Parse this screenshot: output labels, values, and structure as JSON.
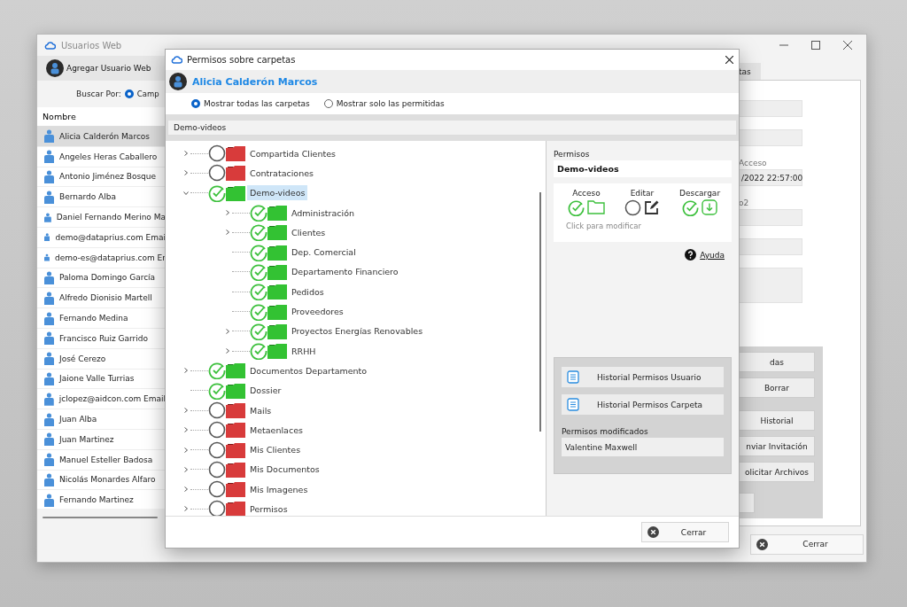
{
  "main_window": {
    "title": "Usuarios Web",
    "add_button": "Agregar Usuario Web",
    "search_label": "Buscar Por:",
    "search_option": {
      "label": "Camp",
      "selected": true
    },
    "list_header": "Nombre",
    "users": [
      {
        "name": "Alicia Calderón Marcos",
        "selected": true
      },
      {
        "name": "Angeles Heras Caballero",
        "selected": false
      },
      {
        "name": "Antonio Jiménez Bosque",
        "selected": false
      },
      {
        "name": "Bernardo Alba",
        "selected": false
      },
      {
        "name": "Daniel Fernando Merino Ma",
        "selected": false
      },
      {
        "name": "demo@dataprius.com Emai",
        "selected": false
      },
      {
        "name": "demo-es@dataprius.com Er",
        "selected": false
      },
      {
        "name": "Paloma Domingo García",
        "selected": false
      },
      {
        "name": "Alfredo Dionisio Martell",
        "selected": false
      },
      {
        "name": "Fernando Medina",
        "selected": false
      },
      {
        "name": "Francisco Ruiz Garrido",
        "selected": false
      },
      {
        "name": "José Cerezo",
        "selected": false
      },
      {
        "name": "Jaione Valle Turrias",
        "selected": false
      },
      {
        "name": "jclopez@aidcon.com Email",
        "selected": false
      },
      {
        "name": "Juan Alba",
        "selected": false
      },
      {
        "name": "Juan Martinez",
        "selected": false
      },
      {
        "name": "Manuel Esteller Badosa",
        "selected": false
      },
      {
        "name": "Nicolás Monardes Alfaro",
        "selected": false
      },
      {
        "name": "Fernando Martinez",
        "selected": false
      }
    ],
    "tab": "tas",
    "fields": [
      {
        "kind": "field"
      },
      {
        "kind": "field"
      },
      {
        "kind": "field",
        "label": "Acceso",
        "value": "/2022 22:57:00"
      },
      {
        "kind": "field",
        "label": "o2"
      },
      {
        "kind": "field"
      },
      {
        "kind": "textarea"
      }
    ],
    "buttons": [
      "das",
      "Borrar",
      "Historial",
      "nviar Invitación",
      "olicitar Archivos"
    ],
    "close_button": "Cerrar"
  },
  "dialog": {
    "title": "Permisos sobre carpetas",
    "user": "Alicia Calderón Marcos",
    "filters": [
      {
        "label": "Mostrar todas las carpetas",
        "selected": true
      },
      {
        "label": "Mostrar solo las permitidas",
        "selected": false
      }
    ],
    "path": "Demo-videos",
    "folders": [
      {
        "name": "Compartida Clientes",
        "granted": false,
        "selected": false,
        "expanded": false
      },
      {
        "name": "Contrataciones",
        "granted": false,
        "selected": false,
        "expanded": false
      },
      {
        "name": "Demo-videos",
        "granted": true,
        "selected": true,
        "expanded": true,
        "children": [
          {
            "name": "Administración",
            "granted": true,
            "selected": false,
            "expanded": false
          },
          {
            "name": "Clientes",
            "granted": true,
            "selected": false,
            "expanded": false
          },
          {
            "name": "Dep. Comercial",
            "granted": true,
            "selected": false
          },
          {
            "name": "Departamento Financiero",
            "granted": true,
            "selected": false
          },
          {
            "name": "Pedidos",
            "granted": true,
            "selected": false
          },
          {
            "name": "Proveedores",
            "granted": true,
            "selected": false
          },
          {
            "name": "Proyectos Energías Renovables",
            "granted": true,
            "selected": false,
            "expanded": false
          },
          {
            "name": "RRHH",
            "granted": true,
            "selected": false,
            "expanded": false
          }
        ]
      },
      {
        "name": "Documentos Departamento",
        "granted": true,
        "selected": false,
        "expanded": false
      },
      {
        "name": "Dossier",
        "granted": true,
        "selected": false
      },
      {
        "name": "Mails",
        "granted": false,
        "selected": false,
        "expanded": false
      },
      {
        "name": "Metaenlaces",
        "granted": false,
        "selected": false,
        "expanded": false
      },
      {
        "name": "Mis Clientes",
        "granted": false,
        "selected": false,
        "expanded": false
      },
      {
        "name": "Mis Documentos",
        "granted": false,
        "selected": false,
        "expanded": false
      },
      {
        "name": "Mis Imagenes",
        "granted": false,
        "selected": false,
        "expanded": false
      },
      {
        "name": "Permisos",
        "granted": false,
        "selected": false,
        "expanded": false
      }
    ],
    "permissions_label": "Permisos",
    "permissions_folder": "Demo-videos",
    "permissions": [
      {
        "label": "Acceso",
        "kind": "access",
        "granted": true
      },
      {
        "label": "Editar",
        "kind": "edit",
        "granted": false
      },
      {
        "label": "Descargar",
        "kind": "download",
        "granted": true
      }
    ],
    "hint": "Click para modificar",
    "help_link": "Ayuda",
    "history_buttons": [
      "Historial Permisos Usuario",
      "Historial Permisos Carpeta"
    ],
    "modified_label": "Permisos modificados",
    "modified_by": "Valentine Maxwell",
    "close_button": "Cerrar"
  }
}
